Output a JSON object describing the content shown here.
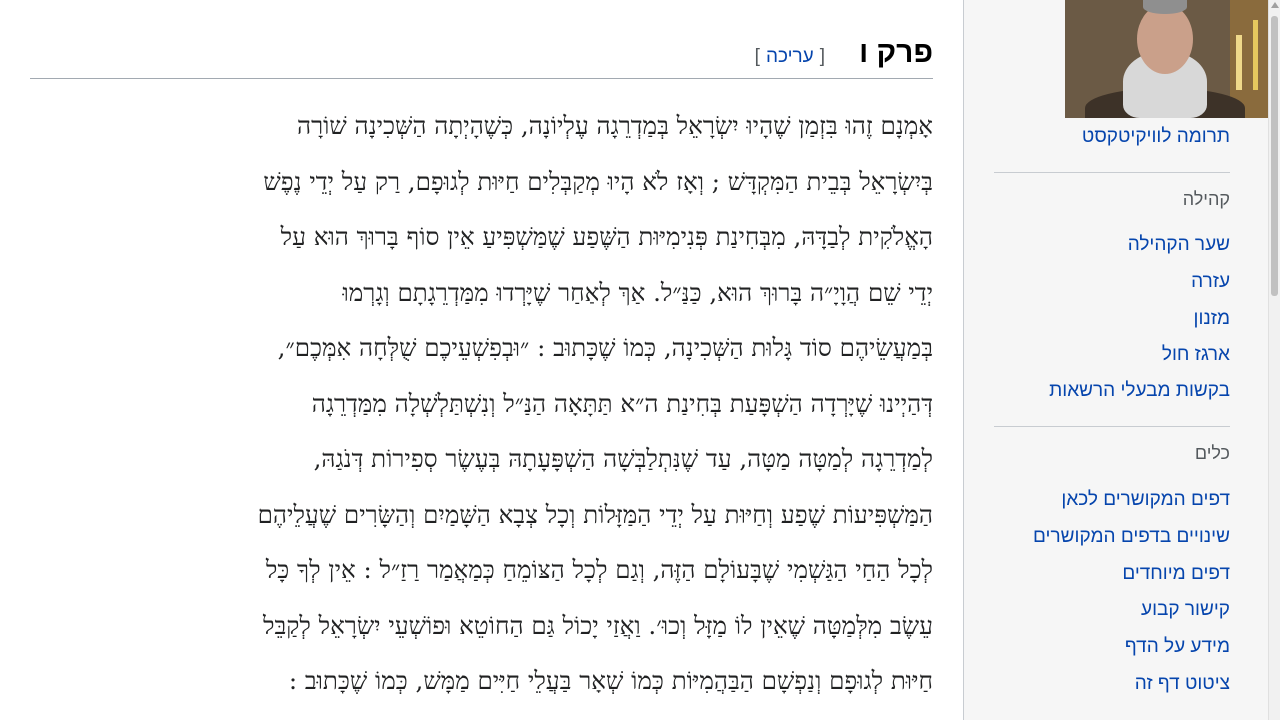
{
  "section": {
    "title": "פרק ו",
    "edit_bracket_open": "[",
    "edit_label": "עריכה",
    "edit_bracket_close": "]"
  },
  "body_lines": [
    "אָמְנָם זֶהוּ בִּזְמַן שֶׁהָיוּ יִשְׂרָאֵל בְּמַדְרֵגָה עֶלְיוֹנָה, כְּשֶׁהָיְתָה הַשְּׁכִינָה שׁוֹרָה",
    "בְּיִשְׂרָאֵל בְּבֵית הַמִּקְדָּשׁ ; וְאָז לֹא הָיוּ מְקַבְּלִים חַיּוּת לְגוּפָם, רַק עַל יְדֵי נֶפֶשׁ",
    "הָאֱלֹקִית לְבַדָּהּ, מִבְּחִינַת פְּנִימִיּוּת הַשֶּׁפַע שֶׁמַּשְׁפִּיעַ אֵין סוֹף בָּרוּךְ הוּא עַל",
    "יְדֵי שֵׁם הֲוָיָ״ה בָּרוּךְ הוּא, כַּנַּ״ל. אַךְ לְאַחַר שֶׁיָּרְדוּ מִמַּדְרֵגָתָם וְגָרְמוּ",
    "בְּמַעֲשֵׂיהֶם סוֹד גָּלוּת הַשְּׁכִינָה, כְּמוֹ שֶׁכָּתוּב : ״וּבְפִשְׁעֵיכֶם שֻׁלְּחָה אִמְּכֶם״,",
    "דְּהַיְינוּ שֶׁיָּרְדָה הַשְׁפָּעַת בְּחִינַת ה״א תַּתָּאָה הַנַּ״ל וְנִשְׁתַּלְשְׁלָה מִמַּדְרֵגָה",
    "לְמַדְרֵגָה לְמַטָּה מַטָּה, עַד שֶׁנִּתְלַבְּשָׁה הַשְׁפָּעָתָהּ בְּעֶשֶׂר סְפִירוֹת דְּנֹגַהּ,",
    "הַמַּשְׁפִּיעוֹת שֶׁפַע וְחַיּוּת עַל יְדֵי הַמַּזָּלוֹת וְכָל צְבָא הַשָּׁמַיִם וְהַשָּׂרִים שֶׁעֲלֵיהֶם",
    "לְכָל הַחַי הַגַּשְׁמִי שֶׁבָּעוֹלָם הַזֶּה, וְגַם לְכָל הַצּוֹמֵחַ כְּמַאֲמַר רַזַ״ל : אֵין לְךָ כָּל",
    "עֵשֶׂב מִלְּמַטָּה שֶׁאֵין לוֹ מַזָּל וְכוּ׳. וַאֲזַי יָכוֹל גַּם הַחוֹטֵא וּפוֹשְׁעֵי יִשְׂרָאֵל לְקַבֵּל",
    "חַיּוּת לְגוּפָם וְנַפְשָׁם הַבַּהֲמִיּוֹת כְּמוֹ שְׁאָר בַּעֲלֵי חַיִּים מַמָּשׁ, כְּמוֹ שֶׁכָּתוּב :"
  ],
  "sidebar": {
    "donate": "תרומה לוויקיטקסט",
    "community_heading": "קהילה",
    "community_links": [
      "שער הקהילה",
      "עזרה",
      "מזנון",
      "ארגז חול",
      "בקשות מבעלי הרשאות"
    ],
    "tools_heading": "כלים",
    "tools_links": [
      "דפים המקושרים לכאן",
      "שינויים בדפים המקושרים",
      "דפים מיוחדים",
      "קישור קבוע",
      "מידע על הדף",
      "ציטוט דף זה"
    ]
  },
  "colors": {
    "link": "#0645ad",
    "sidebar_bg": "#f6f6f6",
    "heading_text": "#000000",
    "muted": "#54595d"
  },
  "icons": {
    "video_overlay": "presenter-video"
  }
}
